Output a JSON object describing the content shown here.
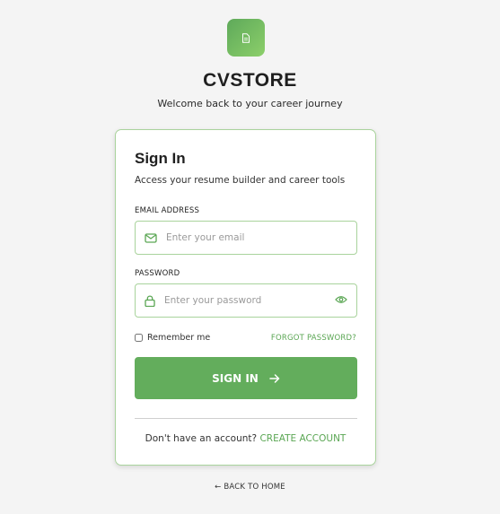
{
  "brand": {
    "name": "CVSTORE",
    "tagline": "Welcome back to your career journey",
    "logo_icon": "document-icon"
  },
  "card": {
    "title": "Sign In",
    "subtitle": "Access your resume builder and career tools",
    "email": {
      "label": "EMAIL ADDRESS",
      "placeholder": "Enter your email",
      "value": "",
      "icon": "mail-icon"
    },
    "password": {
      "label": "PASSWORD",
      "placeholder": "Enter your password",
      "value": "",
      "icon": "lock-icon",
      "toggle_icon": "eye-icon"
    },
    "remember_label": "Remember me",
    "remember_checked": false,
    "forgot_label": "FORGOT PASSWORD?",
    "submit_label": "SIGN IN",
    "signup_prompt": "Don't have an account?",
    "signup_link": "CREATE ACCOUNT"
  },
  "footer": {
    "back_label": "← BACK TO HOME"
  },
  "colors": {
    "accent": "#63ad5c",
    "accent_text": "#5aa653",
    "border": "#a9d39c",
    "background": "#f4f4f4"
  }
}
